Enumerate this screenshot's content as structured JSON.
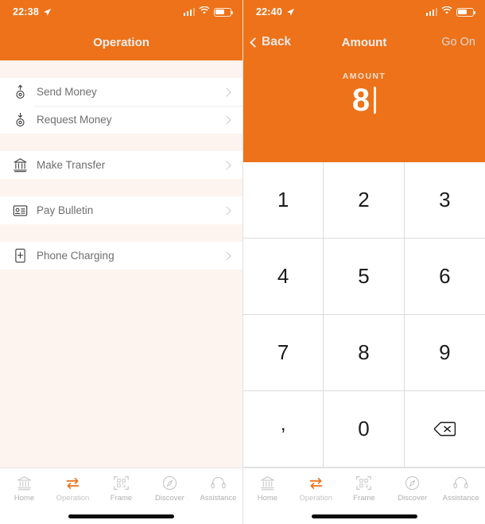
{
  "left": {
    "status": {
      "time": "22:38",
      "location_icon": "location-arrow-icon",
      "signal_icon": "signal-bars-icon",
      "wifi_icon": "wifi-icon",
      "battery_icon": "battery-icon"
    },
    "header": {
      "title": "Operation"
    },
    "groups": [
      {
        "items": [
          {
            "label": "Send Money",
            "icon": "arrow-up-coin-icon",
            "chevron": "chevron-right-icon"
          },
          {
            "label": "Request Money",
            "icon": "arrow-down-coin-icon",
            "chevron": "chevron-right-icon"
          }
        ]
      },
      {
        "items": [
          {
            "label": "Make Transfer",
            "icon": "bank-icon",
            "chevron": "chevron-right-icon"
          }
        ]
      },
      {
        "items": [
          {
            "label": "Pay Bulletin",
            "icon": "bulletin-card-icon",
            "chevron": "chevron-right-icon"
          }
        ]
      },
      {
        "items": [
          {
            "label": "Phone Charging",
            "icon": "phone-charging-icon",
            "chevron": "chevron-right-icon"
          }
        ]
      }
    ]
  },
  "right": {
    "status": {
      "time": "22:40",
      "location_icon": "location-arrow-icon",
      "signal_icon": "signal-bars-icon",
      "wifi_icon": "wifi-icon",
      "battery_icon": "battery-icon"
    },
    "header": {
      "back_label": "Back",
      "title": "Amount",
      "action_label": "Go On"
    },
    "amount": {
      "label": "AMOUNT",
      "value": "8",
      "cursor": true
    },
    "keypad": [
      {
        "key": "1",
        "name": "key-1"
      },
      {
        "key": "2",
        "name": "key-2"
      },
      {
        "key": "3",
        "name": "key-3"
      },
      {
        "key": "4",
        "name": "key-4"
      },
      {
        "key": "5",
        "name": "key-5"
      },
      {
        "key": "6",
        "name": "key-6"
      },
      {
        "key": "7",
        "name": "key-7"
      },
      {
        "key": "8",
        "name": "key-8"
      },
      {
        "key": "9",
        "name": "key-9"
      },
      {
        "key": ",",
        "name": "key-comma"
      },
      {
        "key": "0",
        "name": "key-0"
      },
      {
        "key": "",
        "name": "key-backspace",
        "icon": "backspace-icon"
      }
    ]
  },
  "tabbar": {
    "items": [
      {
        "label": "Home",
        "icon": "bank-building-icon",
        "active": false
      },
      {
        "label": "Operation",
        "icon": "transfer-arrows-icon",
        "active": true
      },
      {
        "label": "Frame",
        "icon": "qr-scan-icon",
        "active": false
      },
      {
        "label": "Discover",
        "icon": "compass-icon",
        "active": false
      },
      {
        "label": "Assistance",
        "icon": "headset-icon",
        "active": false
      }
    ]
  },
  "colors": {
    "brand_orange": "#ED7219",
    "left_bg": "#FDF3EF",
    "divider": "#DCDCDC",
    "key_text": "#1C1C1C"
  }
}
